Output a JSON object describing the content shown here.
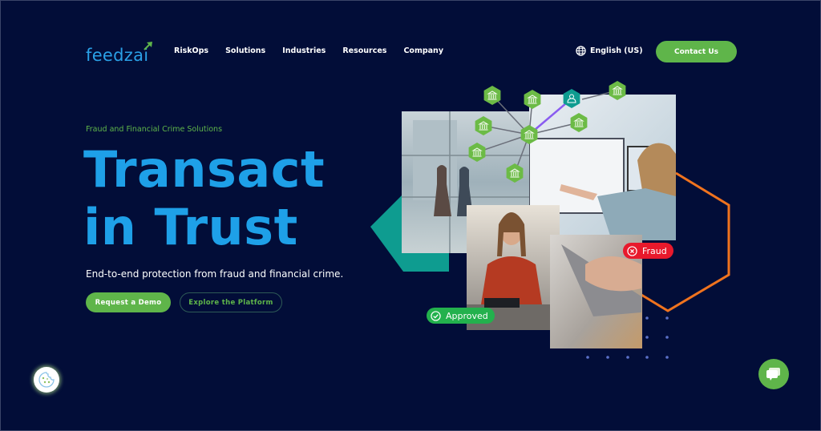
{
  "header": {
    "logo_text": "feedzai",
    "nav": [
      {
        "label": "RiskOps"
      },
      {
        "label": "Solutions"
      },
      {
        "label": "Industries"
      },
      {
        "label": "Resources"
      },
      {
        "label": "Company"
      }
    ],
    "language": "English (US)",
    "contact_label": "Contact Us"
  },
  "hero": {
    "eyebrow": "Fraud and Financial Crime Solutions",
    "headline_line1": "Transact",
    "headline_line2": "in Trust",
    "subline": "End-to-end protection from fraud and financial crime.",
    "primary_cta": "Request a Demo",
    "secondary_cta": "Explore the Platform"
  },
  "illustration": {
    "badge_approved": "Approved",
    "badge_fraud": "Fraud",
    "node_icons": [
      "bank-icon",
      "bank-icon",
      "user-icon",
      "bank-icon",
      "bank-icon",
      "bank-icon",
      "bank-icon",
      "bank-icon",
      "bank-icon",
      "bank-icon"
    ]
  },
  "colors": {
    "background": "#020d38",
    "brand_blue": "#1ea0e8",
    "brand_green": "#5fb54a",
    "teal": "#0e9c90",
    "orange": "#f0731e",
    "approved_green": "#23b14d",
    "fraud_red": "#e8192c"
  }
}
